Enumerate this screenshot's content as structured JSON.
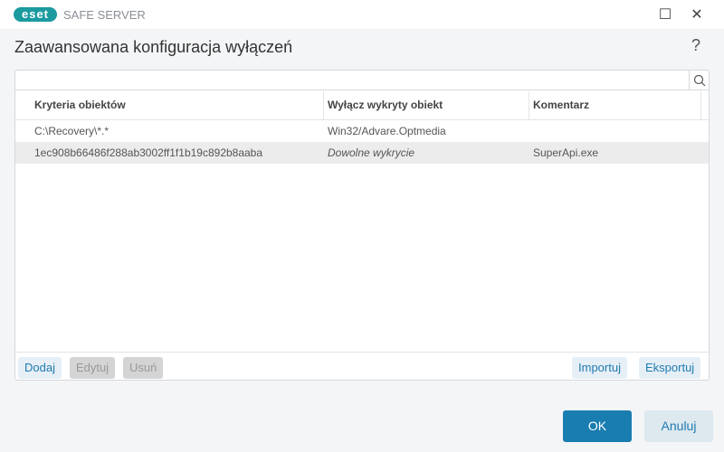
{
  "titlebar": {
    "logo": "eset",
    "product": "SAFE SERVER",
    "minimize": "—",
    "maximize": "☐",
    "close": "✕"
  },
  "dialog": {
    "title": "Zaawansowana konfiguracja wyłączeń",
    "help": "?"
  },
  "search": {
    "value": "",
    "icon": "search-icon"
  },
  "table": {
    "columns": [
      "Kryteria obiektów",
      "Wyłącz wykryty obiekt",
      "Komentarz"
    ],
    "rows": [
      {
        "criteria": "C:\\Recovery\\*.*",
        "detection": "Win32/Advare.Optmedia",
        "comment": ""
      },
      {
        "criteria": "1ec908b66486f288ab3002ff1f1b19c892b8aaba",
        "detection": "Dowolne wykrycie",
        "comment": "SuperApi.exe"
      }
    ]
  },
  "toolbar": {
    "add": "Dodaj",
    "edit": "Edytuj",
    "remove": "Usuń",
    "import": "Importuj",
    "export": "Eksportuj"
  },
  "buttons": {
    "ok": "OK",
    "cancel": "Anuluj"
  },
  "colors": {
    "accent": "#1a7db0",
    "brand": "#1b9aa0"
  }
}
